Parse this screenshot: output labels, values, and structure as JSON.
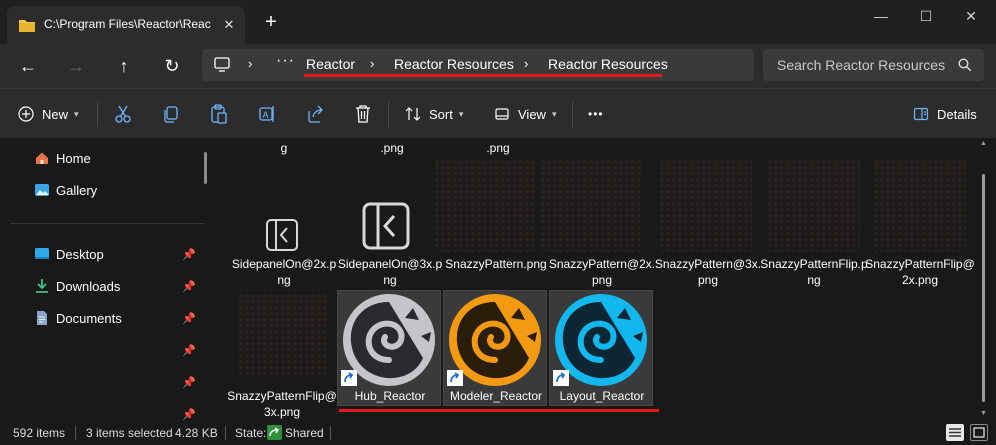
{
  "tab": {
    "title": "C:\\Program Files\\Reactor\\Reac",
    "close_icon": "✕",
    "new_tab_icon": "+"
  },
  "window": {
    "minimize": "—",
    "maximize": "☐",
    "close": "✕"
  },
  "nav": {
    "ellipsis": "···",
    "breadcrumbs": [
      "Reactor",
      "Reactor Resources",
      "Reactor Resources"
    ],
    "search_placeholder": "Search Reactor Resources"
  },
  "commands": {
    "new": "New",
    "sort": "Sort",
    "view": "View",
    "more": "•••",
    "details": "Details"
  },
  "sidebar": {
    "items": [
      {
        "label": "Home",
        "icon": "home-icon",
        "pinned": false
      },
      {
        "label": "Gallery",
        "icon": "gallery-icon",
        "pinned": false
      },
      {
        "label": "Desktop",
        "icon": "desktop-icon",
        "pinned": true
      },
      {
        "label": "Downloads",
        "icon": "downloads-icon",
        "pinned": true
      },
      {
        "label": "Documents",
        "icon": "documents-icon",
        "pinned": true
      }
    ],
    "pin_icon": "📌"
  },
  "files": {
    "top_partial": [
      "g",
      ".png",
      ".png"
    ],
    "row2": [
      {
        "name": "SidepanelOn@2x.png"
      },
      {
        "name": "SidepanelOn@3x.png"
      },
      {
        "name": "SnazzyPattern.png"
      },
      {
        "name": "SnazzyPattern@2x.png"
      },
      {
        "name": "SnazzyPattern@3x.png"
      },
      {
        "name": "SnazzyPatternFlip.png"
      },
      {
        "name": "SnazzyPatternFlip@2x.png"
      }
    ],
    "row3": [
      {
        "name": "SnazzyPatternFlip@3x.png",
        "selected": false
      },
      {
        "name": "Hub_Reactor",
        "selected": true,
        "color": "#c4c5c9"
      },
      {
        "name": "Modeler_Reactor",
        "selected": true,
        "color": "#f39a12"
      },
      {
        "name": "Layout_Reactor",
        "selected": true,
        "color": "#12b7ee"
      }
    ]
  },
  "status": {
    "items": "592 items",
    "selected": "3 items selected",
    "size": "4.28 KB",
    "state_label": "State:",
    "state_value": "Shared"
  },
  "colors": {
    "accent_red": "#e8141e",
    "bg": "#191919",
    "bar": "#2c2c2c"
  }
}
